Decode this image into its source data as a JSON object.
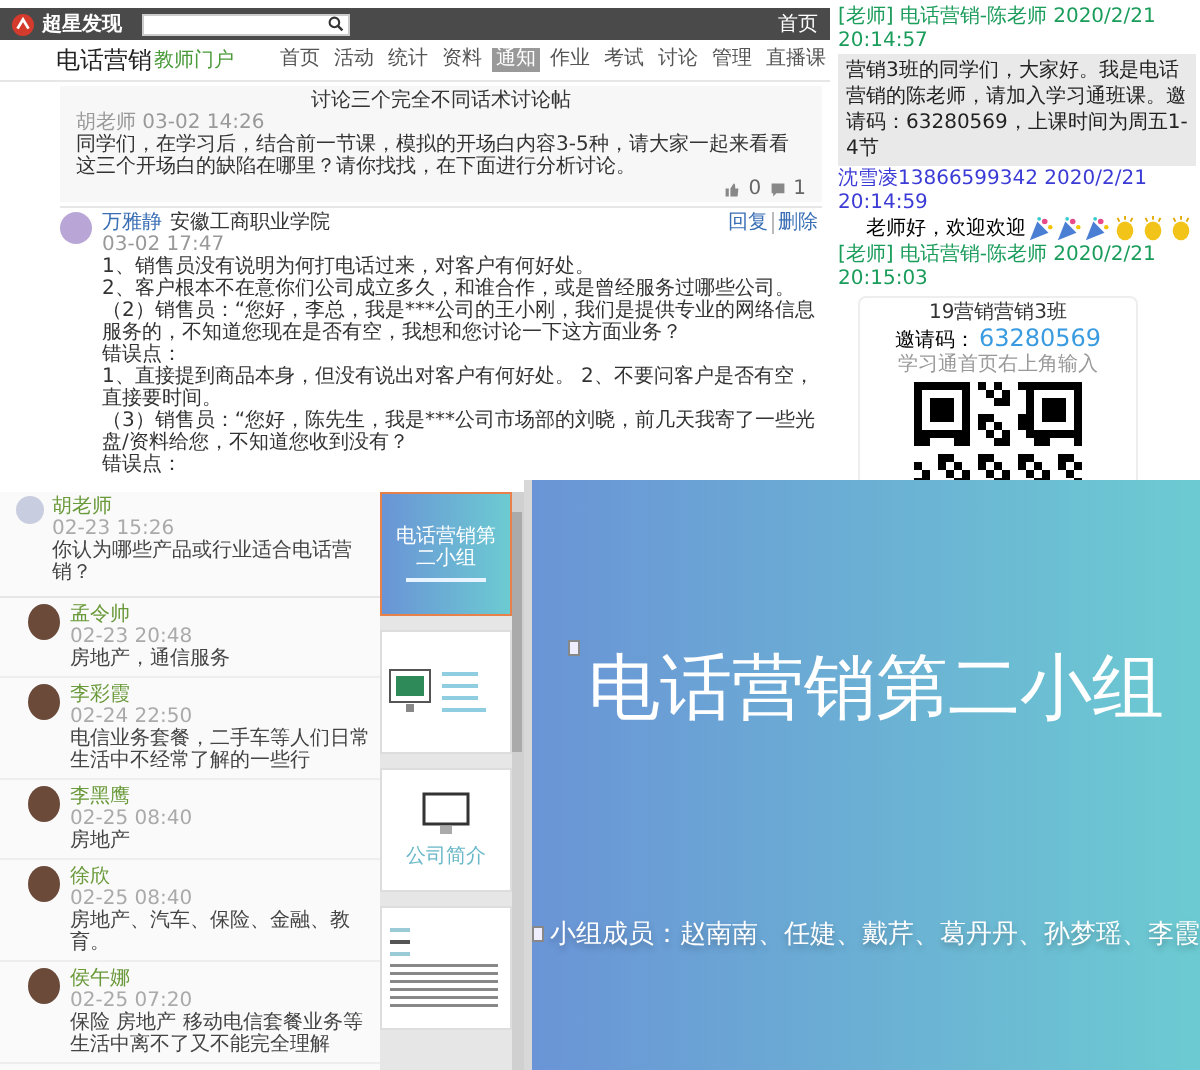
{
  "forum": {
    "logo": "超星发现",
    "top_link": "首页",
    "course_title": "电话营销",
    "portal_label": "教师门户",
    "nav": [
      {
        "label": "首页",
        "selected": false
      },
      {
        "label": "活动",
        "selected": false
      },
      {
        "label": "统计",
        "selected": false
      },
      {
        "label": "资料",
        "selected": false
      },
      {
        "label": "通知",
        "selected": true
      },
      {
        "label": "作业",
        "selected": false
      },
      {
        "label": "考试",
        "selected": false
      },
      {
        "label": "讨论",
        "selected": false
      },
      {
        "label": "管理",
        "selected": false
      },
      {
        "label": "直播课",
        "selected": false
      }
    ],
    "post": {
      "title": "讨论三个完全不同话术讨论帖",
      "author": "胡老师",
      "time": "03-02 14:26",
      "body": "同学们，在学习后，结合前一节课，模拟的开场白内容3-5种，请大家一起来看看这三个开场白的缺陷在哪里？请你找找，在下面进行分析讨论。",
      "likes": "0",
      "comments": "1"
    },
    "reply": {
      "author": "万雅静",
      "school": "安徽工商职业学院",
      "time": "03-02 17:47",
      "actions": [
        "回复",
        "删除"
      ],
      "paragraphs": [
        "1、销售员没有说明为何打电话过来，对客户有何好处。",
        "2、客户根本不在意你们公司成立多久，和谁合作，或是曾经服务过哪些公司。",
        "（2）销售员：“您好，李总，我是***公司的王小刚，我们是提供专业的网络信息服务的，不知道您现在是否有空，我想和您讨论一下这方面业务？",
        "错误点：",
        "1、直接提到商品本身，但没有说出对客户有何好处。 2、不要问客户是否有空，直接要时间。",
        "（3）销售员：“您好，陈先生，我是***公司市场部的刘晓，前几天我寄了一些光盘/资料给您，不知道您收到没有？",
        "错误点："
      ]
    }
  },
  "chat": {
    "messages": [
      {
        "kind": "teacher-text",
        "tag": "[老师]",
        "header": "电话营销-陈老师 2020/2/21 20:14:57",
        "text": "营销3班的同学们，大家好。我是电话营销的陈老师，请加入学习通班课。邀请码：63280569，上课时间为周五1-4节"
      },
      {
        "kind": "student-text",
        "header": "沈雪凌13866599342 2020/2/21 20:14:59",
        "text": "老师好，欢迎欢迎"
      },
      {
        "kind": "teacher-card",
        "tag": "[老师]",
        "header": "电话营销-陈老师 2020/2/21 20:15:03",
        "card": {
          "class_name": "19营销营销3班",
          "code_label": "邀请码：",
          "code": "63280569",
          "hint": "学习通首页右上角输入"
        }
      }
    ]
  },
  "discussion": {
    "author": "胡老师",
    "time": "02-23 15:26",
    "question": "你认为哪些产品或行业适合电话营销？",
    "replies": [
      {
        "name": "孟令帅",
        "time": "02-23 20:48",
        "text": "房地产，通信服务"
      },
      {
        "name": "李彩霞",
        "time": "02-24 22:50",
        "text": "电信业务套餐，二手车等人们日常生活中不经常了解的一些行"
      },
      {
        "name": "李黑鹰",
        "time": "02-25 08:40",
        "text": "房地产"
      },
      {
        "name": "徐欣",
        "time": "02-25 08:40",
        "text": "房地产、汽车、保险、金融、教育。"
      },
      {
        "name": "侯午娜",
        "time": "02-25 07:20",
        "text": "保险 房地产 移动电信套餐业务等生活中离不了又不能完全理解"
      }
    ]
  },
  "thumbnails": [
    {
      "kind": "title",
      "selected": true,
      "title": "电话营销第二小组"
    },
    {
      "kind": "contents",
      "selected": false
    },
    {
      "kind": "section",
      "selected": false,
      "caption": "公司简介"
    },
    {
      "kind": "text",
      "selected": false
    }
  ],
  "slide": {
    "title": "电话营销第二小组",
    "members": "小组成员：赵南南、任婕、戴芹、葛丹丹、孙梦瑶、李霞"
  }
}
